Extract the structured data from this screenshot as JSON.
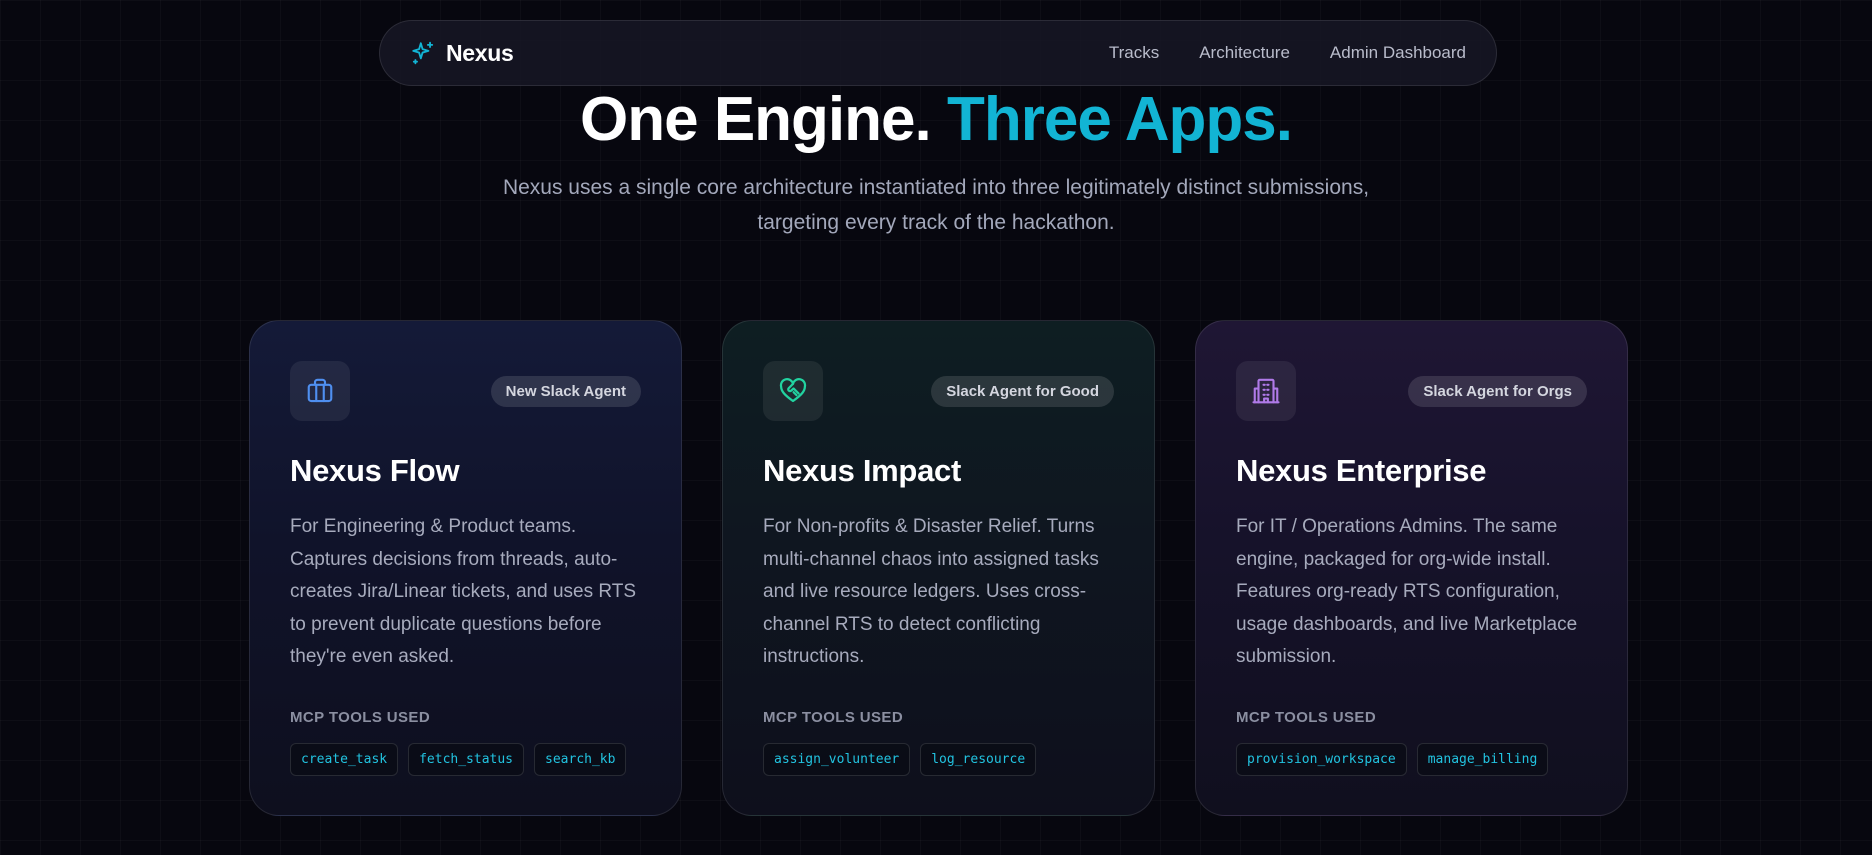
{
  "nav": {
    "brand": "Nexus",
    "links": [
      "Tracks",
      "Architecture",
      "Admin Dashboard"
    ]
  },
  "hero": {
    "title_main": "One Engine.",
    "title_accent": "Three Apps.",
    "subtitle": "Nexus uses a single core architecture instantiated into three legitimately distinct submissions, targeting every track of the hackathon."
  },
  "colors": {
    "accent": "#12b4d4",
    "flow_icon": "#4f8ff0",
    "impact_icon": "#22d3a0",
    "enterprise_icon": "#b07ae8"
  },
  "cards": [
    {
      "icon": "briefcase-icon",
      "badge": "New Slack Agent",
      "title": "Nexus Flow",
      "description": "For Engineering & Product teams. Captures decisions from threads, auto-creates Jira/Linear tickets, and uses RTS to prevent duplicate questions before they're even asked.",
      "tools_label": "MCP TOOLS USED",
      "tools": [
        "create_task",
        "fetch_status",
        "search_kb"
      ]
    },
    {
      "icon": "heart-handshake-icon",
      "badge": "Slack Agent for Good",
      "title": "Nexus Impact",
      "description": "For Non-profits & Disaster Relief. Turns multi-channel chaos into assigned tasks and live resource ledgers. Uses cross-channel RTS to detect conflicting instructions.",
      "tools_label": "MCP TOOLS USED",
      "tools": [
        "assign_volunteer",
        "log_resource"
      ]
    },
    {
      "icon": "building-icon",
      "badge": "Slack Agent for Orgs",
      "title": "Nexus Enterprise",
      "description": "For IT / Operations Admins. The same engine, packaged for org-wide install. Features org-ready RTS configuration, usage dashboards, and live Marketplace submission.",
      "tools_label": "MCP TOOLS USED",
      "tools": [
        "provision_workspace",
        "manage_billing"
      ]
    }
  ]
}
